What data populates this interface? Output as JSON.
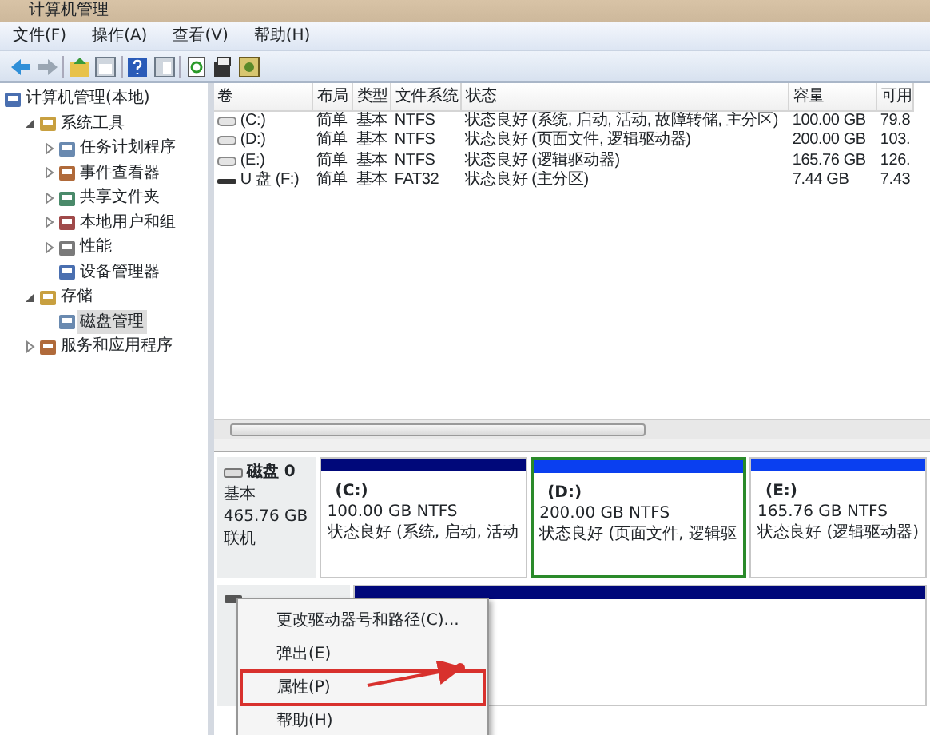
{
  "window": {
    "title": "计算机管理"
  },
  "menu": [
    "文件(F)",
    "操作(A)",
    "查看(V)",
    "帮助(H)"
  ],
  "tree": [
    {
      "label": "计算机管理(本地)",
      "selected": false,
      "children": [
        {
          "label": "系统工具",
          "selected": false,
          "expanded": true,
          "children": [
            {
              "label": "任务计划程序",
              "selected": false,
              "expanded": false
            },
            {
              "label": "事件查看器",
              "selected": false,
              "expanded": false
            },
            {
              "label": "共享文件夹",
              "selected": false,
              "expanded": false
            },
            {
              "label": "本地用户和组",
              "selected": false,
              "expanded": false
            },
            {
              "label": "性能",
              "selected": false,
              "expanded": false
            },
            {
              "label": "设备管理器",
              "selected": false
            }
          ]
        },
        {
          "label": "存储",
          "selected": false,
          "expanded": true,
          "children": [
            {
              "label": "磁盘管理",
              "selected": true
            }
          ]
        },
        {
          "label": "服务和应用程序",
          "selected": false,
          "expanded": false
        }
      ]
    }
  ],
  "table": {
    "columns": [
      "卷",
      "布局",
      "类型",
      "文件系统",
      "状态",
      "容量",
      "可用"
    ],
    "rows": [
      {
        "kind": "disk",
        "cells": [
          "(C:)",
          "简单",
          "基本",
          "NTFS",
          "状态良好 (系统, 启动, 活动, 故障转储, 主分区)",
          "100.00 GB",
          "79.8"
        ]
      },
      {
        "kind": "disk",
        "cells": [
          "(D:)",
          "简单",
          "基本",
          "NTFS",
          "状态良好 (页面文件, 逻辑驱动器)",
          "200.00 GB",
          "103."
        ]
      },
      {
        "kind": "disk",
        "cells": [
          "(E:)",
          "简单",
          "基本",
          "NTFS",
          "状态良好 (逻辑驱动器)",
          "165.76 GB",
          "126."
        ]
      },
      {
        "kind": "usb",
        "cells": [
          "U 盘 (F:)",
          "简单",
          "基本",
          "FAT32",
          "状态良好 (主分区)",
          "7.44 GB",
          "7.43"
        ]
      }
    ]
  },
  "disks": [
    {
      "label": "磁盘 0",
      "type": "基本",
      "size": "465.76 GB",
      "status": "联机",
      "partitions": [
        {
          "kind": "primary",
          "selected": false,
          "name": "(C:)",
          "size": "100.00 GB NTFS",
          "status": "状态良好 (系统, 启动, 活动"
        },
        {
          "kind": "logical",
          "selected": true,
          "name": "(D:)",
          "size": "200.00 GB NTFS",
          "status": "状态良好 (页面文件, 逻辑驱"
        },
        {
          "kind": "logical",
          "selected": false,
          "name": "(E:)",
          "size": "165.76 GB NTFS",
          "status": "状态良好 (逻辑驱动器)"
        }
      ]
    },
    {
      "partitions": [
        {
          "kind": "primary",
          "selected": false
        }
      ]
    }
  ],
  "context_menu": [
    {
      "label": "更改驱动器号和路径(C)...",
      "annotated": false
    },
    {
      "label": "弹出(E)",
      "annotated": false
    },
    {
      "label": "属性(P)",
      "annotated": true
    },
    {
      "label": "帮助(H)",
      "annotated": false
    }
  ]
}
